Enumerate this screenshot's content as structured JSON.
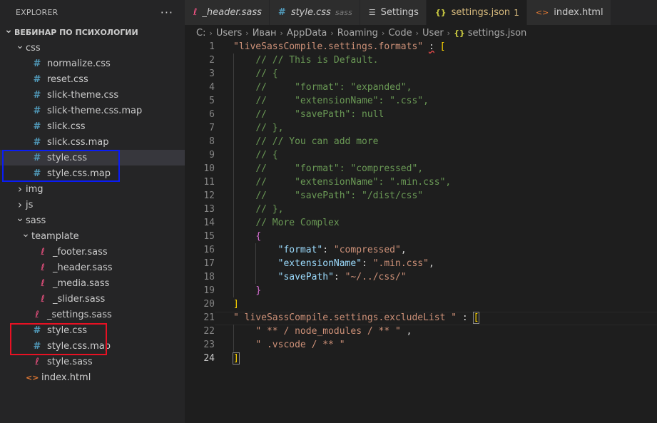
{
  "explorer": {
    "title": "EXPLORER",
    "more": "···",
    "tree": [
      {
        "label": "ВЕБИНАР ПО ПСИХОЛОГИИ",
        "type": "root",
        "depth": 0,
        "chevron": "open"
      },
      {
        "label": "css",
        "type": "folder",
        "depth": 1,
        "chevron": "open"
      },
      {
        "label": "normalize.css",
        "type": "css",
        "depth": 2
      },
      {
        "label": "reset.css",
        "type": "css",
        "depth": 2
      },
      {
        "label": "slick-theme.css",
        "type": "css",
        "depth": 2
      },
      {
        "label": "slick-theme.css.map",
        "type": "css",
        "depth": 2
      },
      {
        "label": "slick.css",
        "type": "css",
        "depth": 2
      },
      {
        "label": "slick.css.map",
        "type": "css",
        "depth": 2
      },
      {
        "label": "style.css",
        "type": "css",
        "depth": 2,
        "selected": true
      },
      {
        "label": "style.css.map",
        "type": "css",
        "depth": 2
      },
      {
        "label": "img",
        "type": "folder",
        "depth": 1,
        "chevron": "closed"
      },
      {
        "label": "js",
        "type": "folder",
        "depth": 1,
        "chevron": "closed"
      },
      {
        "label": "sass",
        "type": "folder",
        "depth": 1,
        "chevron": "open"
      },
      {
        "label": "teamplate",
        "type": "folder",
        "depth": 2,
        "chevron": "open"
      },
      {
        "label": "_footer.sass",
        "type": "sass",
        "depth": 3
      },
      {
        "label": "_header.sass",
        "type": "sass",
        "depth": 3
      },
      {
        "label": "_media.sass",
        "type": "sass",
        "depth": 3
      },
      {
        "label": "_slider.sass",
        "type": "sass",
        "depth": 3
      },
      {
        "label": "_settings.sass",
        "type": "sass",
        "depth": 2
      },
      {
        "label": "style.css",
        "type": "css",
        "depth": 2
      },
      {
        "label": "style.css.map",
        "type": "css",
        "depth": 2
      },
      {
        "label": "style.sass",
        "type": "sass",
        "depth": 2
      },
      {
        "label": "index.html",
        "type": "html",
        "depth": 1
      }
    ],
    "highlight_colors": {
      "blue": "#0a1cf5",
      "red": "#e81123"
    }
  },
  "tabs": [
    {
      "label": "_header.sass",
      "icon": "sass-icon",
      "style": "sass"
    },
    {
      "label": "style.css",
      "hint": "sass",
      "icon": "hash-icon",
      "style": "css"
    },
    {
      "label": "Settings",
      "icon": "settings-list-icon",
      "style": "settings"
    },
    {
      "label": "settings.json",
      "badge": "1",
      "icon": "json-braces-icon",
      "style": "json",
      "active": true
    },
    {
      "label": "index.html",
      "icon": "html-icon",
      "style": "html"
    }
  ],
  "breadcrumb": [
    "C:",
    "Users",
    "Иван",
    "AppData",
    "Roaming",
    "Code",
    "User",
    "settings.json"
  ],
  "breadcrumb_file_icon": "{}",
  "code": {
    "current_line": 24,
    "lines": [
      {
        "n": 1,
        "segs": [
          {
            "t": "\"liveSassCompile.settings.formats\"",
            "c": "str"
          },
          {
            "t": " ",
            "c": "p"
          },
          {
            "t": ":",
            "c": "p",
            "squig": true
          },
          {
            "t": " ",
            "c": "p"
          },
          {
            "t": "[",
            "c": "b1"
          }
        ]
      },
      {
        "n": 2,
        "indent": 1,
        "segs": [
          {
            "t": "// // This is Default.",
            "c": "cm"
          }
        ]
      },
      {
        "n": 3,
        "indent": 1,
        "segs": [
          {
            "t": "// {",
            "c": "cm"
          }
        ]
      },
      {
        "n": 4,
        "indent": 1,
        "segs": [
          {
            "t": "//     \"format\": \"expanded\",",
            "c": "cm"
          }
        ]
      },
      {
        "n": 5,
        "indent": 1,
        "segs": [
          {
            "t": "//     \"extensionName\": \".css\",",
            "c": "cm"
          }
        ]
      },
      {
        "n": 6,
        "indent": 1,
        "segs": [
          {
            "t": "//     \"savePath\": null",
            "c": "cm"
          }
        ]
      },
      {
        "n": 7,
        "indent": 1,
        "segs": [
          {
            "t": "// },",
            "c": "cm"
          }
        ]
      },
      {
        "n": 8,
        "indent": 1,
        "segs": [
          {
            "t": "// // You can add more",
            "c": "cm"
          }
        ]
      },
      {
        "n": 9,
        "indent": 1,
        "segs": [
          {
            "t": "// {",
            "c": "cm"
          }
        ]
      },
      {
        "n": 10,
        "indent": 1,
        "segs": [
          {
            "t": "//     \"format\": \"compressed\",",
            "c": "cm"
          }
        ]
      },
      {
        "n": 11,
        "indent": 1,
        "segs": [
          {
            "t": "//     \"extensionName\": \".min.css\",",
            "c": "cm"
          }
        ]
      },
      {
        "n": 12,
        "indent": 1,
        "segs": [
          {
            "t": "//     \"savePath\": \"/dist/css\"",
            "c": "cm"
          }
        ]
      },
      {
        "n": 13,
        "indent": 1,
        "segs": [
          {
            "t": "// },",
            "c": "cm"
          }
        ]
      },
      {
        "n": 14,
        "indent": 1,
        "segs": [
          {
            "t": "// More Complex",
            "c": "cm"
          }
        ]
      },
      {
        "n": 15,
        "indent": 1,
        "segs": [
          {
            "t": "{",
            "c": "b2"
          }
        ]
      },
      {
        "n": 16,
        "indent": 2,
        "segs": [
          {
            "t": "\"format\"",
            "c": "key"
          },
          {
            "t": ": ",
            "c": "p"
          },
          {
            "t": "\"compressed\"",
            "c": "str"
          },
          {
            "t": ",",
            "c": "p"
          }
        ]
      },
      {
        "n": 17,
        "indent": 2,
        "segs": [
          {
            "t": "\"extensionName\"",
            "c": "key"
          },
          {
            "t": ": ",
            "c": "p"
          },
          {
            "t": "\".min.css\"",
            "c": "str"
          },
          {
            "t": ",",
            "c": "p"
          }
        ]
      },
      {
        "n": 18,
        "indent": 2,
        "segs": [
          {
            "t": "\"savePath\"",
            "c": "key"
          },
          {
            "t": ": ",
            "c": "p"
          },
          {
            "t": "\"~/../css/\"",
            "c": "str"
          }
        ]
      },
      {
        "n": 19,
        "indent": 1,
        "segs": [
          {
            "t": "}",
            "c": "b2"
          }
        ]
      },
      {
        "n": 20,
        "indent": 0,
        "segs": [
          {
            "t": "]",
            "c": "b1"
          }
        ]
      },
      {
        "n": 21,
        "indent": 0,
        "segs": [
          {
            "t": "\" liveSassCompile.settings.excludeList \"",
            "c": "str"
          },
          {
            "t": " : ",
            "c": "p"
          },
          {
            "t": "[",
            "c": "b1",
            "box": true
          }
        ]
      },
      {
        "n": 22,
        "indent": 1,
        "segs": [
          {
            "t": "\" ** / node_modules / ** \"",
            "c": "str"
          },
          {
            "t": " ,",
            "c": "p"
          }
        ]
      },
      {
        "n": 23,
        "indent": 1,
        "segs": [
          {
            "t": "\" .vscode / ** \"",
            "c": "str"
          }
        ]
      },
      {
        "n": 24,
        "indent": 0,
        "segs": [
          {
            "t": "]",
            "c": "b1",
            "box": true
          }
        ]
      }
    ]
  }
}
